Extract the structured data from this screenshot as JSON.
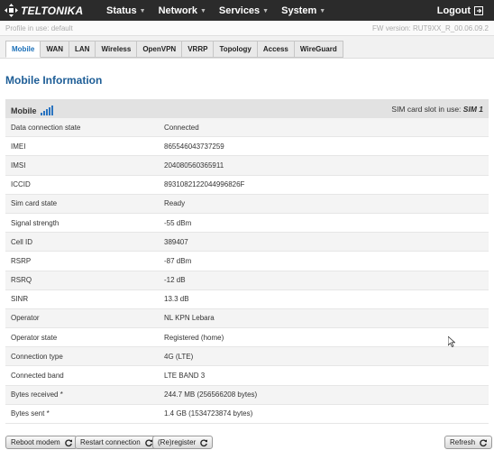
{
  "brand": {
    "name": "TELTONIKA"
  },
  "nav": {
    "items": [
      {
        "label": "Status"
      },
      {
        "label": "Network"
      },
      {
        "label": "Services"
      },
      {
        "label": "System"
      }
    ],
    "logout": "Logout"
  },
  "infobar": {
    "profile": "Profile in use: default",
    "fw": "FW version: RUT9XX_R_00.06.09.2"
  },
  "tabs": [
    {
      "label": "Mobile",
      "active": true
    },
    {
      "label": "WAN"
    },
    {
      "label": "LAN"
    },
    {
      "label": "Wireless"
    },
    {
      "label": "OpenVPN"
    },
    {
      "label": "VRRP"
    },
    {
      "label": "Topology"
    },
    {
      "label": "Access"
    },
    {
      "label": "WireGuard"
    }
  ],
  "page": {
    "title": "Mobile Information",
    "section_title": "Mobile",
    "sim_label": "SIM card slot in use:",
    "sim_value": "SIM 1",
    "signal_icon": "signal-strength-icon",
    "rows": [
      {
        "key": "Data connection state",
        "value": "Connected"
      },
      {
        "key": "IMEI",
        "value": "865546043737259"
      },
      {
        "key": "IMSI",
        "value": "204080560365911"
      },
      {
        "key": "ICCID",
        "value": "8931082122044996826F"
      },
      {
        "key": "Sim card state",
        "value": "Ready"
      },
      {
        "key": "Signal strength",
        "value": "-55 dBm"
      },
      {
        "key": "Cell ID",
        "value": "389407"
      },
      {
        "key": "RSRP",
        "value": "-87 dBm"
      },
      {
        "key": "RSRQ",
        "value": "-12 dB"
      },
      {
        "key": "SINR",
        "value": "13.3 dB"
      },
      {
        "key": "Operator",
        "value": "NL KPN Lebara"
      },
      {
        "key": "Operator state",
        "value": "Registered (home)"
      },
      {
        "key": "Connection type",
        "value": "4G (LTE)"
      },
      {
        "key": "Connected band",
        "value": "LTE BAND 3"
      },
      {
        "key": "Bytes received *",
        "value": "244.7 MB (256566208 bytes)"
      },
      {
        "key": "Bytes sent *",
        "value": "1.4 GB (1534723874 bytes)"
      }
    ]
  },
  "actions": {
    "reboot": "Reboot modem",
    "restart": "Restart connection",
    "reregister": "(Re)register",
    "refresh": "Refresh"
  },
  "colors": {
    "navbar": "#2b2b2b",
    "title": "#1d5d96",
    "active_tab": "#1a6fb8"
  }
}
